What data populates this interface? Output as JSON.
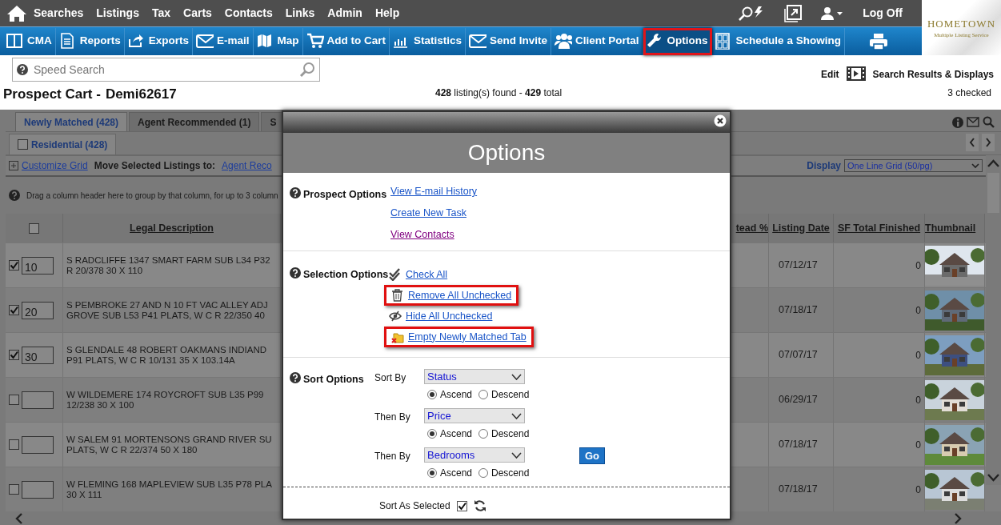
{
  "top_menu": {
    "items": [
      {
        "label": "Searches"
      },
      {
        "label": "Listings"
      },
      {
        "label": "Tax"
      },
      {
        "label": "Carts"
      },
      {
        "label": "Contacts"
      },
      {
        "label": "Links"
      },
      {
        "label": "Admin"
      },
      {
        "label": "Help"
      }
    ],
    "log_off": "Log Off"
  },
  "toolbar": {
    "items": [
      {
        "label": "CMA",
        "highlighted": false
      },
      {
        "label": "Reports",
        "highlighted": false
      },
      {
        "label": "Exports",
        "highlighted": false
      },
      {
        "label": "E-mail",
        "highlighted": false
      },
      {
        "label": "Map",
        "highlighted": false
      },
      {
        "label": "Add to Cart",
        "highlighted": false
      },
      {
        "label": "Statistics",
        "highlighted": false
      },
      {
        "label": "Send Invite",
        "highlighted": false
      },
      {
        "label": "Client Portal",
        "highlighted": false
      },
      {
        "label": "Options",
        "highlighted": true
      },
      {
        "label": "Schedule a Showing",
        "highlighted": false
      }
    ]
  },
  "logo": {
    "name": "HOMETOWN",
    "tagline": "Multiple Listing Service"
  },
  "speed_search": {
    "placeholder": "Speed Search"
  },
  "page_title": {
    "title": "Prospect Cart -",
    "prospect": "Demi62617"
  },
  "result_summary": "**428** listing(s) found - **429** total",
  "header_links": {
    "edit": "Edit",
    "displays": "Search Results & Displays",
    "checked_count": "3 checked"
  },
  "cart_tabs": [
    {
      "label": "Newly Matched (428)",
      "selected": true
    },
    {
      "label": "Agent Recommended (1)",
      "selected": false
    },
    {
      "label": "S",
      "selected": false
    }
  ],
  "property_tabs": [
    {
      "label": "Residential (428)",
      "checked": false
    }
  ],
  "grid_toolbar": {
    "customize": "Customize Grid",
    "move_label": "Move Selected Listings to:",
    "move_target": "Agent Reco",
    "display_label": "Display",
    "display_value": "One Line Grid (50/pg)"
  },
  "group_hint": "Drag a column header here to group by that column, for up to 3 column",
  "grid": {
    "select_all": {
      "checked": false
    },
    "columns": [
      "Legal Description",
      "tead %",
      "Listing Date",
      "SF Total Finished",
      "Thumbnail"
    ],
    "rows": [
      {
        "checked": true,
        "order": "10",
        "legal_description": "S RADCLIFFE 1347 SMART FARM SUB L34 P32\nR 20/378 30 X 110",
        "listing_date": "07/12/17",
        "sf_total_finished": "0"
      },
      {
        "checked": true,
        "order": "20",
        "legal_description": "S PEMBROKE 27 AND N 10 FT VAC ALLEY ADJ\nGROVE SUB L53 P41 PLATS, W C R 22/350 40",
        "listing_date": "07/18/17",
        "sf_total_finished": "0"
      },
      {
        "checked": true,
        "order": "30",
        "legal_description": "S GLENDALE 48 ROBERT OAKMANS INDIAND\nP91 PLATS, W C R 10/131 35 X 103.14A",
        "listing_date": "07/07/17",
        "sf_total_finished": "0"
      },
      {
        "checked": false,
        "legal_description": "W WILDEMERE 174 ROYCROFT SUB L35 P99\n12/238 30 X 100",
        "listing_date": "06/29/17",
        "sf_total_finished": "0"
      },
      {
        "checked": false,
        "legal_description": "W SALEM 91 MORTENSONS GRAND RIVER SU\nPLATS, W C R 22/374 50 X 180",
        "listing_date": "07/18/17",
        "sf_total_finished": "0"
      },
      {
        "checked": false,
        "legal_description": "W FLEMING 168 MAPLEVIEW SUB L35 P78 PLA\n30 X 111",
        "listing_date": "07/18/17",
        "sf_total_finished": "0"
      }
    ]
  },
  "modal": {
    "title": "Options",
    "prospect_options": {
      "label": "Prospect Options",
      "links": [
        {
          "text": "View E-mail History",
          "visited": false
        },
        {
          "text": "Create New Task",
          "visited": false
        },
        {
          "text": "View Contacts",
          "visited": true
        }
      ]
    },
    "selection_options": {
      "label": "Selection Options",
      "actions": [
        {
          "text": "Check All",
          "highlighted": false
        },
        {
          "text": "Remove All Unchecked",
          "highlighted": true
        },
        {
          "text": "Hide All Unchecked",
          "highlighted": false
        },
        {
          "text": "Empty Newly Matched Tab",
          "highlighted": true
        }
      ]
    },
    "sort_options": {
      "label": "Sort Options",
      "levels": [
        {
          "label": "Sort By",
          "value": "Status",
          "directions": [
            {
              "label": "Ascend",
              "selected": true
            },
            {
              "label": "Descend",
              "selected": false
            }
          ]
        },
        {
          "label": "Then By",
          "value": "Price",
          "directions": [
            {
              "label": "Ascend",
              "selected": true
            },
            {
              "label": "Descend",
              "selected": false
            }
          ]
        },
        {
          "label": "Then By",
          "value": "Bedrooms",
          "directions": [
            {
              "label": "Ascend",
              "selected": true
            },
            {
              "label": "Descend",
              "selected": false
            }
          ]
        }
      ],
      "go": "Go",
      "sort_as_selected": {
        "label": "Sort As Selected",
        "checked": true
      }
    }
  }
}
